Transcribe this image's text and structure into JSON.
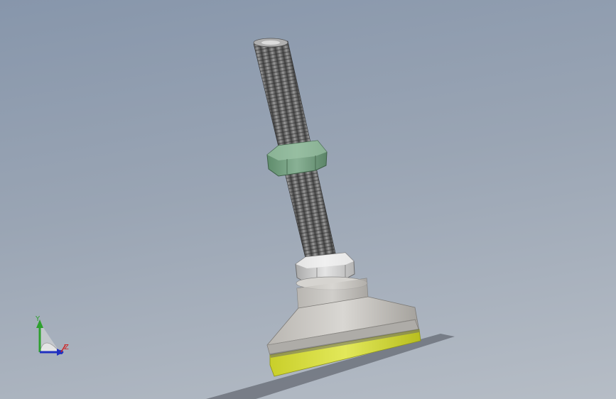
{
  "viewport": {
    "background_top": "#8796ab",
    "background_bottom": "#b6bdc6"
  },
  "model": {
    "name": "leveling-foot",
    "parts": [
      "threaded-stud",
      "lock-nut",
      "hex-nut",
      "washer",
      "base",
      "pad"
    ],
    "colors": {
      "stud": "#6f6f6f",
      "lock_nut": "#6f9a7c",
      "hex_nut": "#c9c9c9",
      "base": "#c4c2bf",
      "pad": "#d6dc3c"
    }
  },
  "triad": {
    "y_label": "Y",
    "z_label": "Z",
    "x_label": "X",
    "y_color": "#2ea02e",
    "x_color": "#d02020",
    "z_color": "#2030c0"
  }
}
